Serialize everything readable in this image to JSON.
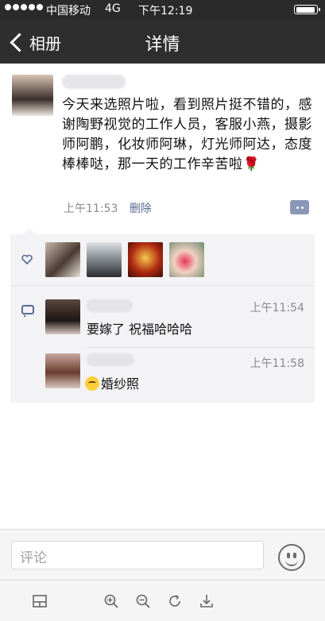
{
  "status_bar": {
    "carrier": "中国移动",
    "network": "4G",
    "time": "下午12:19",
    "signal_bars": 5,
    "battery_level": 0.95
  },
  "nav": {
    "back_label": "相册",
    "title": "详情"
  },
  "post": {
    "text": "今天来选照片啦，看到照片挺不错的，感谢陶野视觉的工作人员，客服小燕，摄影师阿鹏，化妆师阿琳，灯光师阿达，态度棒棒哒，那一天的工作辛苦啦🌹",
    "time": "上午11:53",
    "delete_label": "删除"
  },
  "likes": {
    "count": 4,
    "icon": "heart-icon"
  },
  "comments": [
    {
      "time": "上午11:54",
      "text": "要嫁了 祝福哈哈哈"
    },
    {
      "time": "上午11:58",
      "text": "婚纱照",
      "emoji": "grin-emoji"
    }
  ],
  "comment_input": {
    "placeholder": "评论"
  },
  "colors": {
    "nav_bg": "#2e2e2e",
    "link": "#576b95",
    "panel_bg": "#f3f3f5"
  }
}
